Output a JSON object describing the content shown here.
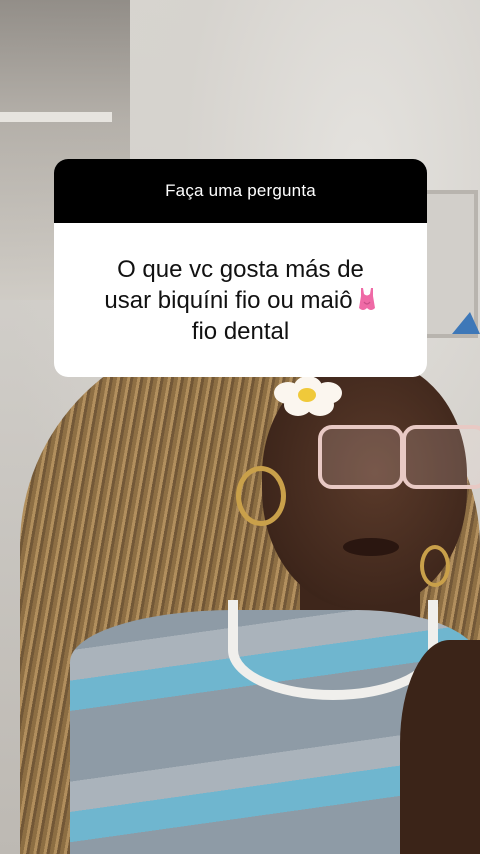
{
  "question_sticker": {
    "header": "Faça uma pergunta",
    "question_line1": "O que vc gosta más de",
    "question_line2": "usar biquíni fio ou maiô",
    "question_line3": "fio dental",
    "emoji": "one-piece-swimsuit-icon"
  },
  "colors": {
    "header_bg": "#000000",
    "card_bg": "#ffffff",
    "swimsuit": "#ef6aa6"
  }
}
